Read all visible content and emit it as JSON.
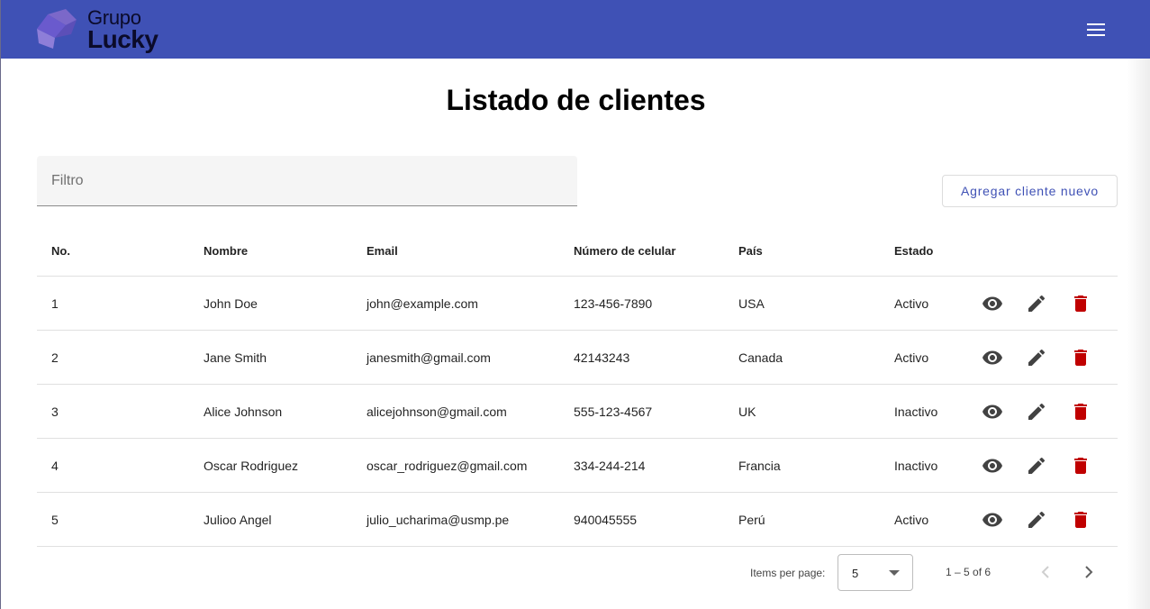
{
  "header": {
    "logo_line1": "Grupo",
    "logo_line2": "Lucky",
    "menu_icon": "hamburger-menu-icon",
    "bar_color": "#3f51b5"
  },
  "page": {
    "title": "Listado de clientes"
  },
  "filter": {
    "placeholder": "Filtro",
    "value": ""
  },
  "actions": {
    "add_label": "Agregar cliente nuevo"
  },
  "table": {
    "columns": [
      "No.",
      "Nombre",
      "Email",
      "Número de celular",
      "País",
      "Estado"
    ],
    "rows": [
      [
        "1",
        "John Doe",
        "john@example.com",
        "123-456-7890",
        "USA",
        "Activo"
      ],
      [
        "2",
        "Jane Smith",
        "janesmith@gmail.com",
        "42143243",
        "Canada",
        "Activo"
      ],
      [
        "3",
        "Alice Johnson",
        "alicejohnson@gmail.com",
        "555-123-4567",
        "UK",
        "Inactivo"
      ],
      [
        "4",
        "Oscar Rodriguez",
        "oscar_rodriguez@gmail.com",
        "334-244-214",
        "Francia",
        "Inactivo"
      ],
      [
        "5",
        "Julioo Angel",
        "julio_ucharima@usmp.pe",
        "940045555",
        "Perú",
        "Activo"
      ]
    ],
    "row_action_icons": [
      "eye-icon",
      "pencil-icon",
      "trash-icon"
    ],
    "delete_color": "#c00000"
  },
  "paginator": {
    "items_per_page_label": "Items per page:",
    "page_size": "5",
    "range_label": "1 – 5 of 6"
  }
}
